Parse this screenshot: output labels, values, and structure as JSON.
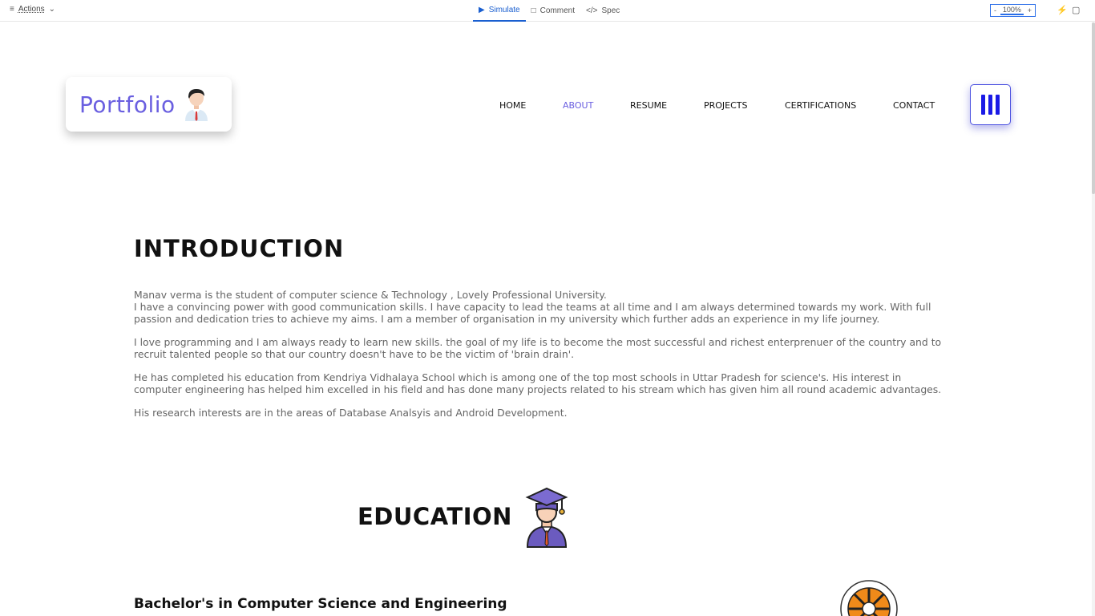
{
  "toolbar": {
    "actions_label": "Actions",
    "tabs": [
      {
        "label": "Simulate"
      },
      {
        "label": "Comment"
      },
      {
        "label": "Spec"
      }
    ],
    "zoom_minus": "-",
    "zoom_value": "100%",
    "zoom_plus": "+"
  },
  "header": {
    "logo_text": "Portfolio",
    "nav": [
      {
        "label": "HOME"
      },
      {
        "label": "ABOUT"
      },
      {
        "label": "RESUME"
      },
      {
        "label": "PROJECTS"
      },
      {
        "label": "CERTIFICATIONS"
      },
      {
        "label": "CONTACT"
      }
    ],
    "active_nav": "ABOUT"
  },
  "intro": {
    "title": "INTRODUCTION",
    "paragraphs": [
      "Manav verma is the student of computer science & Technology , Lovely Professional University.\nI have a convincing power with good communication skills. I have capacity to lead the teams at all time and I am always determined towards my work. With full passion and dedication tries to achieve my aims.  I am a member of organisation in my university which further adds an experience in my life journey.",
      "I love programming and I am always ready to learn new skills.  the goal of my life is to become the most successful and richest enterprenuer of the country and to recruit talented people so that our country doesn't have to be the victim of 'brain drain'.",
      "He has completed his education from Kendriya Vidhalaya School which is among one of the top most schools in Uttar Pradesh for science's.    His interest in computer engineering has helped him excelled in his field and has done many projects related to his stream which has given him all round academic advantages.",
      "His research interests are in the areas of Database Analsyis and Android Development."
    ]
  },
  "education": {
    "title": "EDUCATION",
    "degree": "Bachelor's in Computer Science and Engineering"
  },
  "colors": {
    "accent": "#6a5fe0",
    "menu_blue": "#1a1ae6",
    "toolbar_active": "#1a5fd0"
  }
}
